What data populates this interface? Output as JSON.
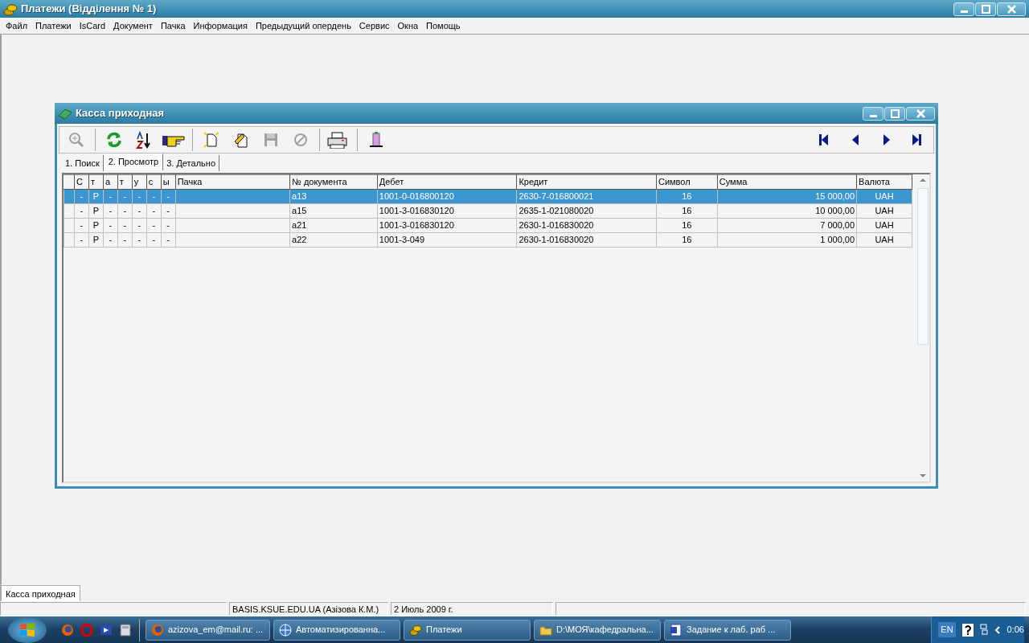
{
  "app": {
    "title": "Платежи (Відділення № 1)"
  },
  "menu": [
    "Файл",
    "Платежи",
    "IsCard",
    "Документ",
    "Пачка",
    "Информация",
    "Предыдущий опердень",
    "Сервис",
    "Окна",
    "Помощь"
  ],
  "child_window": {
    "title": "Касса приходная",
    "toolbar": [
      {
        "kind": "zoom",
        "disabled": true
      },
      {
        "kind": "sep"
      },
      {
        "kind": "refresh",
        "disabled": false
      },
      {
        "kind": "sort",
        "disabled": false
      },
      {
        "kind": "hand",
        "disabled": false
      },
      {
        "kind": "sep"
      },
      {
        "kind": "new",
        "disabled": false
      },
      {
        "kind": "edit",
        "disabled": false
      },
      {
        "kind": "save",
        "disabled": true
      },
      {
        "kind": "cancel",
        "disabled": true
      },
      {
        "kind": "sep"
      },
      {
        "kind": "print",
        "disabled": false
      },
      {
        "kind": "sep"
      },
      {
        "kind": "exit",
        "disabled": false
      }
    ],
    "tabs": [
      {
        "label": "1. Поиск",
        "selected": false
      },
      {
        "label": "2. Просмотр",
        "selected": true
      },
      {
        "label": "3. Детально",
        "selected": false
      }
    ],
    "table": {
      "columns": [
        "С",
        "т",
        "а",
        "т",
        "у",
        "с",
        "ы",
        "Пачка",
        "№ документа",
        "Дебет",
        "Кредит",
        "Символ",
        "Сумма",
        "Валюта"
      ],
      "rows": [
        {
          "selected": true,
          "cells": [
            "-",
            "Р",
            "-",
            "-",
            "-",
            "-",
            "-",
            "",
            "a13",
            "1001-0-016800120",
            "2630-7-016800021",
            "16",
            "15 000,00",
            "UAH"
          ]
        },
        {
          "selected": false,
          "cells": [
            "-",
            "Р",
            "-",
            "-",
            "-",
            "-",
            "-",
            "",
            "a15",
            "1001-3-016830120",
            "2635-1-021080020",
            "16",
            "10 000,00",
            "UAH"
          ]
        },
        {
          "selected": false,
          "cells": [
            "-",
            "Р",
            "-",
            "-",
            "-",
            "-",
            "-",
            "",
            "a21",
            "1001-3-016830120",
            "2630-1-016830020",
            "16",
            "7 000,00",
            "UAH"
          ]
        },
        {
          "selected": false,
          "cells": [
            "-",
            "Р",
            "-",
            "-",
            "-",
            "-",
            "-",
            "",
            "a22",
            "1001-3-049",
            "2630-1-016830020",
            "16",
            "1 000,00",
            "UAH"
          ]
        }
      ]
    }
  },
  "window_tabs": [
    "Касса приходная"
  ],
  "status_bar": [
    "BASIS.KSUE.EDU.UA (Азізова К.М.)",
    "2 Июль 2009 г."
  ],
  "taskbar": {
    "tasks": [
      "azizova_em@mail.ru: ...",
      "Автоматизированна...",
      "Платежи",
      "D:\\МОЯ\\кафедральна...",
      "Задание к лаб. раб ..."
    ],
    "language": "EN",
    "clock": "0:06"
  }
}
